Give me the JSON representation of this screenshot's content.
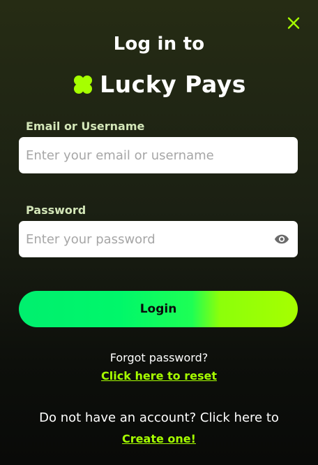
{
  "colors": {
    "accent": "#a6ff00",
    "label": "#d3e6b8",
    "button_start": "#00ef6e",
    "button_end": "#a6ff00"
  },
  "header": {
    "title": "Log in to",
    "brand_name": "Lucky Pays",
    "close_icon": "close-icon"
  },
  "form": {
    "email_label": "Email or Username",
    "email_value": "",
    "email_placeholder": "Enter your email or username",
    "password_label": "Password",
    "password_value": "",
    "password_placeholder": "Enter your password",
    "password_toggle_icon": "eye-icon",
    "login_label": "Login"
  },
  "footer": {
    "forgot_text": "Forgot password?",
    "reset_link": "Click here to reset",
    "signup_text": "Do not have an account? Click here to",
    "create_link": "Create one!"
  }
}
